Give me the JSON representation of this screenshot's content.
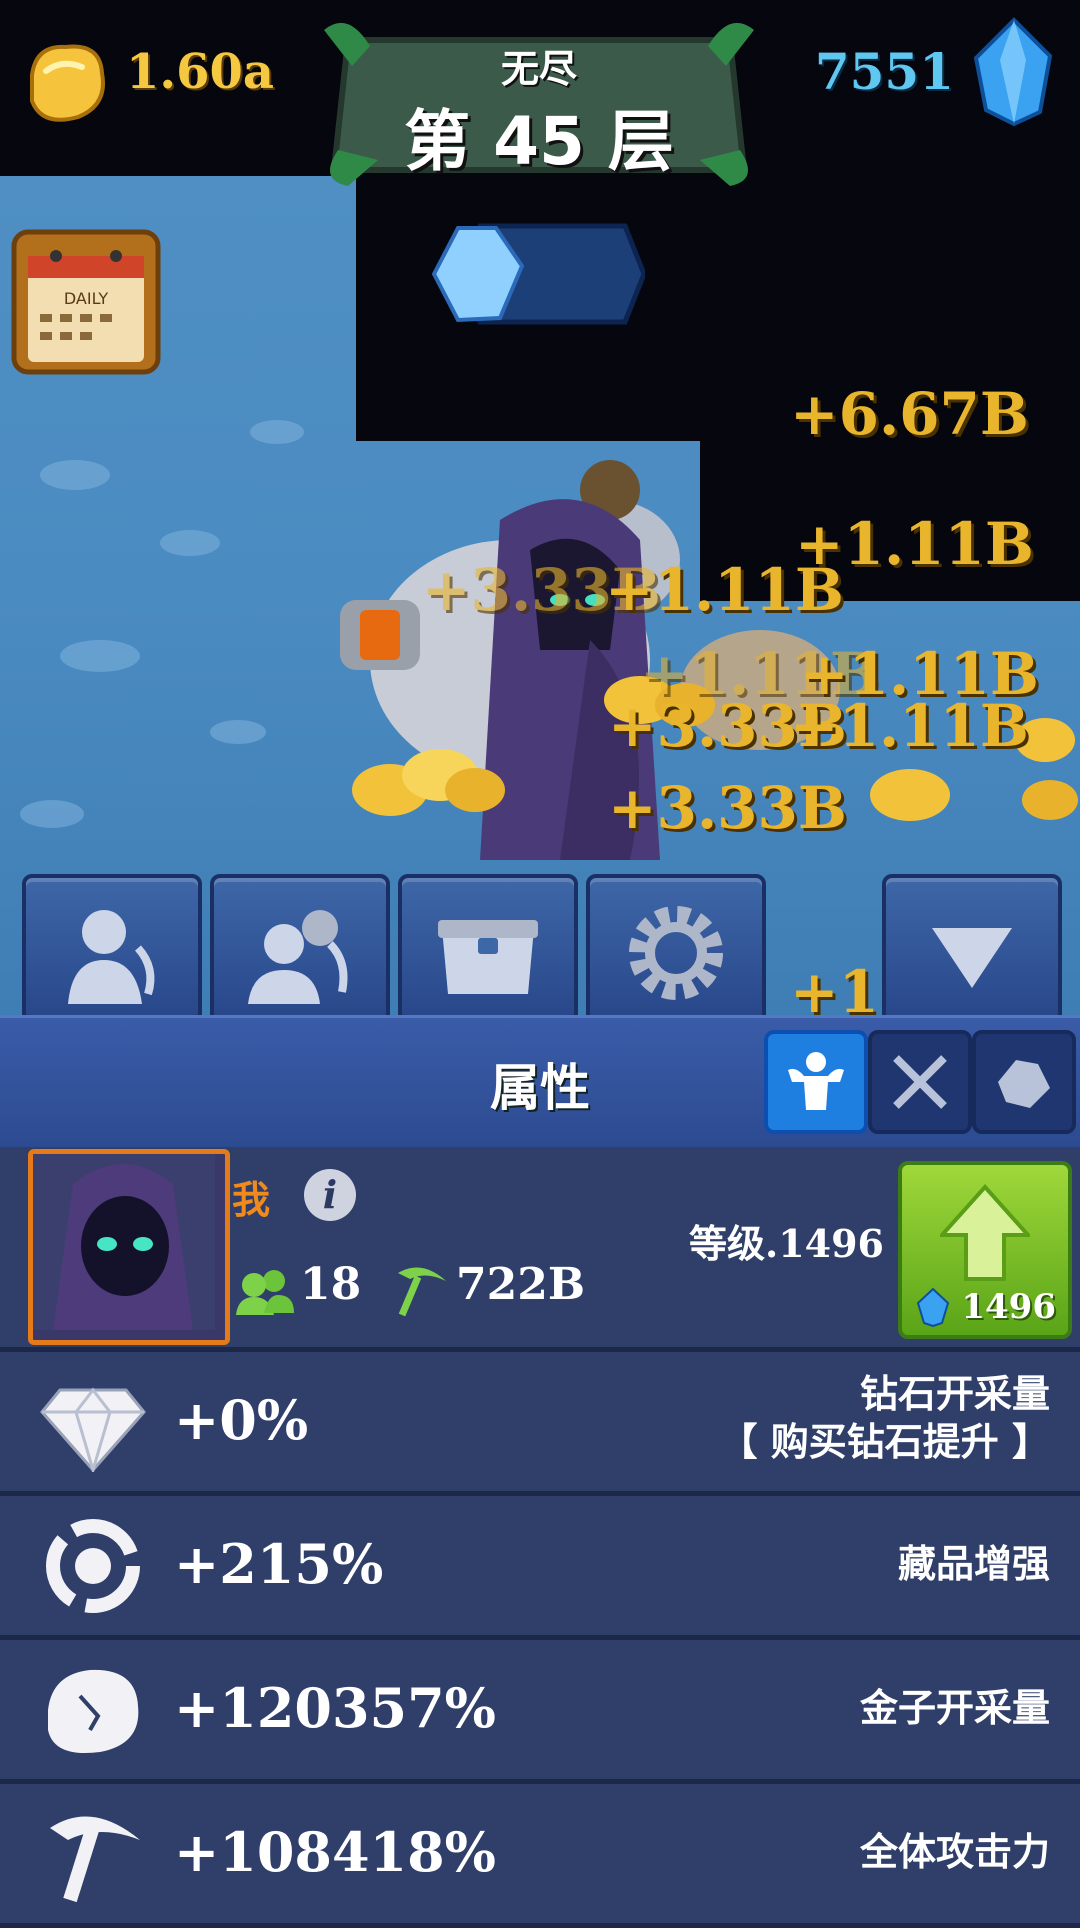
{
  "top_bar": {
    "gold_value": "1.60a",
    "gems_value": "7551",
    "level_mode": "无尽",
    "level_title": "第 45 层",
    "daily_label": "DAILY"
  },
  "floating_rewards": [
    "+6.67B",
    "+1.11B",
    "+3.33B",
    "+1.11B",
    "+1.11B",
    "+1.11B",
    "+3.33B",
    "+1.11B",
    "+3.33B",
    "+1"
  ],
  "action_buttons": [
    {
      "icon": "hero-pickaxe-icon"
    },
    {
      "icon": "team-pickaxe-icon"
    },
    {
      "icon": "chest-icon"
    },
    {
      "icon": "gear-icon"
    },
    {
      "icon": "collapse-arrow-icon"
    }
  ],
  "panel": {
    "title": "属性",
    "tabs": [
      {
        "icon": "strength-icon",
        "active": true
      },
      {
        "icon": "crossed-swords-icon",
        "active": false
      },
      {
        "icon": "ore-icon",
        "active": false
      }
    ]
  },
  "hero": {
    "name": "我",
    "info_symbol": "i",
    "team_count": "18",
    "mining_power": "722B",
    "level_text": "等级.1496",
    "upgrade_cost": "1496"
  },
  "stats": [
    {
      "icon": "diamond-icon",
      "value": "+0%",
      "label": "钻石开采量",
      "sublabel": "【 购买钻石提升 】"
    },
    {
      "icon": "relic-ring-icon",
      "value": "+215%",
      "label": "藏品增强",
      "sublabel": ""
    },
    {
      "icon": "gold-nugget-icon",
      "value": "+120357%",
      "label": "金子开采量",
      "sublabel": ""
    },
    {
      "icon": "pickaxe-icon",
      "value": "+108418%",
      "label": "全体攻击力",
      "sublabel": ""
    }
  ],
  "colors": {
    "gold_text": "#f5c842",
    "gem_text": "#5fc8f0",
    "reward_text": "#e8b52c",
    "hero_name": "#f08a1c",
    "panel_bg": "#2f3f6a",
    "tab_active": "#1f7fe0",
    "upgrade_green": "#7cc22a"
  }
}
